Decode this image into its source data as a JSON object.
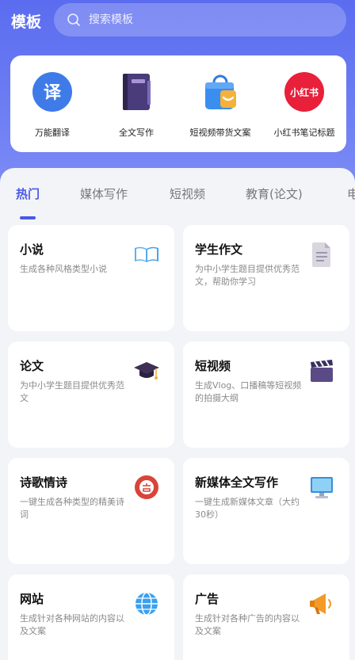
{
  "header": {
    "title": "模板",
    "search_placeholder": "搜索模板"
  },
  "tools": [
    {
      "label": "万能翻译",
      "icon": "translate-icon"
    },
    {
      "label": "全文写作",
      "icon": "notebook-icon"
    },
    {
      "label": "短视频带货文案",
      "icon": "shopping-bag-icon"
    },
    {
      "label": "小红书笔记标题",
      "icon": "xiaohongshu-icon",
      "logo_text": "小红书"
    }
  ],
  "translate_glyph": "译",
  "tabs": [
    "热门",
    "媒体写作",
    "短视频",
    "教育(论文)",
    "电"
  ],
  "cards": [
    {
      "title": "小说",
      "desc": "生成各种风格类型小说",
      "icon": "open-book-icon"
    },
    {
      "title": "学生作文",
      "desc": "为中小学生题目提供优秀范文，帮助你学习",
      "icon": "document-icon"
    },
    {
      "title": "论文",
      "desc": "为中小学生题目提供优秀范文",
      "icon": "graduation-cap-icon"
    },
    {
      "title": "短视频",
      "desc": "生成Vlog、口播稿等短视频的拍摄大纲",
      "icon": "clapperboard-icon"
    },
    {
      "title": "诗歌情诗",
      "desc": "一键生成各种类型的精美诗词",
      "icon": "poem-seal-icon"
    },
    {
      "title": "新媒体全文写作",
      "desc": "一键生成新媒体文章（大约30秒）",
      "icon": "monitor-icon"
    },
    {
      "title": "网站",
      "desc": "生成针对各种网站的内容以及文案",
      "icon": "globe-icon"
    },
    {
      "title": "广告",
      "desc": "生成针对各种广告的内容以及文案",
      "icon": "megaphone-icon"
    }
  ],
  "colors": {
    "accent": "#4a58e6",
    "header_gradient_top": "#5b6cf0",
    "header_gradient_bottom": "#7f8ef5"
  }
}
